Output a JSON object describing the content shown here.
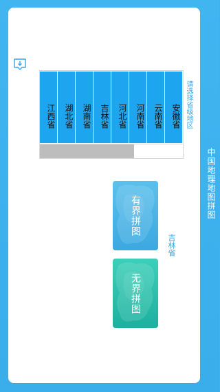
{
  "app": {
    "title": "中国地理地图拼图"
  },
  "icons": {
    "share": "share-icon"
  },
  "region_select": {
    "hint": "请选择省级地区",
    "provinces": [
      "安徽省",
      "云南省",
      "河南省",
      "河北省",
      "吉林省",
      "湖南省",
      "湖北省",
      "江西省"
    ],
    "scroll_position": 0.66
  },
  "selected_province": "吉林省",
  "modes": {
    "bounded_label": "有界拼图",
    "boundless_label": "无界拼图"
  },
  "colors": {
    "background": "#3fb2ec",
    "province_button": "#1ea5f0",
    "accent_text": "#3aa4e6",
    "bounded_button": "#4db6e8",
    "boundless_button": "#2cc0ab"
  }
}
